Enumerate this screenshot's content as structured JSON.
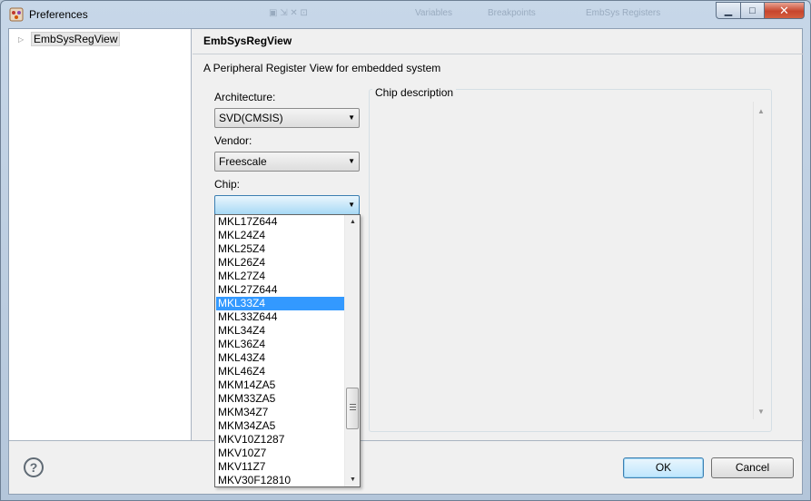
{
  "window": {
    "title": "Preferences",
    "ghost_tabs": [
      "Variables",
      "Breakpoints",
      "EmbSys Registers"
    ]
  },
  "tree": {
    "items": [
      {
        "label": "EmbSysRegView"
      }
    ]
  },
  "page": {
    "title": "EmbSysRegView",
    "description": "A Peripheral Register View for embedded system"
  },
  "form": {
    "architecture_label": "Architecture:",
    "architecture_value": "SVD(CMSIS)",
    "vendor_label": "Vendor:",
    "vendor_value": "Freescale",
    "chip_label": "Chip:",
    "chip_value": "",
    "chip_description_label": "Chip description"
  },
  "chip_list": {
    "items": [
      "MKL17Z644",
      "MKL24Z4",
      "MKL25Z4",
      "MKL26Z4",
      "MKL27Z4",
      "MKL27Z644",
      "MKL33Z4",
      "MKL33Z644",
      "MKL34Z4",
      "MKL36Z4",
      "MKL43Z4",
      "MKL46Z4",
      "MKM14ZA5",
      "MKM33ZA5",
      "MKM34Z7",
      "MKM34ZA5",
      "MKV10Z1287",
      "MKV10Z7",
      "MKV11Z7",
      "MKV30F12810"
    ],
    "selected": "MKL33Z4"
  },
  "buttons": {
    "ok": "OK",
    "cancel": "Cancel",
    "help": "?"
  },
  "colors": {
    "selection": "#3399ff",
    "ok_border": "#3c7fb1"
  }
}
